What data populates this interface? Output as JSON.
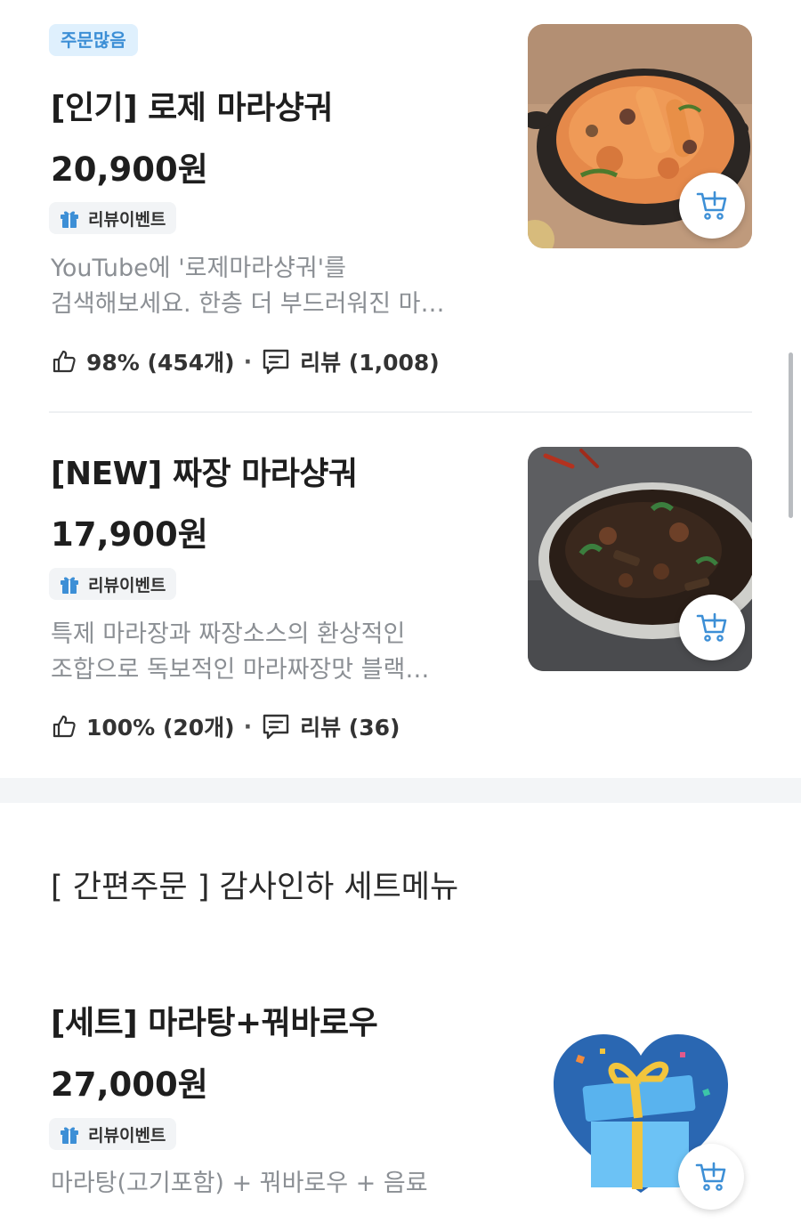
{
  "items": [
    {
      "top_badge": "주문많음",
      "title": "[인기] 로제 마라샹궈",
      "price": "20,900원",
      "event_badge": "리뷰이벤트",
      "desc_line1": "YouTube에 '로제마라샹궈'를",
      "desc_line2": "검색해보세요. 한층 더 부드러워진 마…",
      "rating": "98% (454개)",
      "reviews": "리뷰 (1,008)"
    },
    {
      "title": "[NEW] 짜장 마라샹궈",
      "price": "17,900원",
      "event_badge": "리뷰이벤트",
      "desc_line1": "특제 마라장과 짜장소스의 환상적인",
      "desc_line2": "조합으로 독보적인 마라짜장맛 블랙…",
      "rating": "100% (20개)",
      "reviews": "리뷰 (36)"
    }
  ],
  "section": {
    "title": "[ 간편주문 ] 감사인하 세트메뉴"
  },
  "set_item": {
    "title": "[세트] 마라탕+꿔바로우",
    "price": "27,000원",
    "event_badge": "리뷰이벤트",
    "desc": "마라탕(고기포함) + 꿔바로우 + 음료"
  },
  "separator": "·",
  "colors": {
    "accent_blue": "#3d8fd6",
    "badge_bg": "#dff0fd",
    "desc_gray": "#8b8f94",
    "section_gap": "#f3f5f7"
  }
}
